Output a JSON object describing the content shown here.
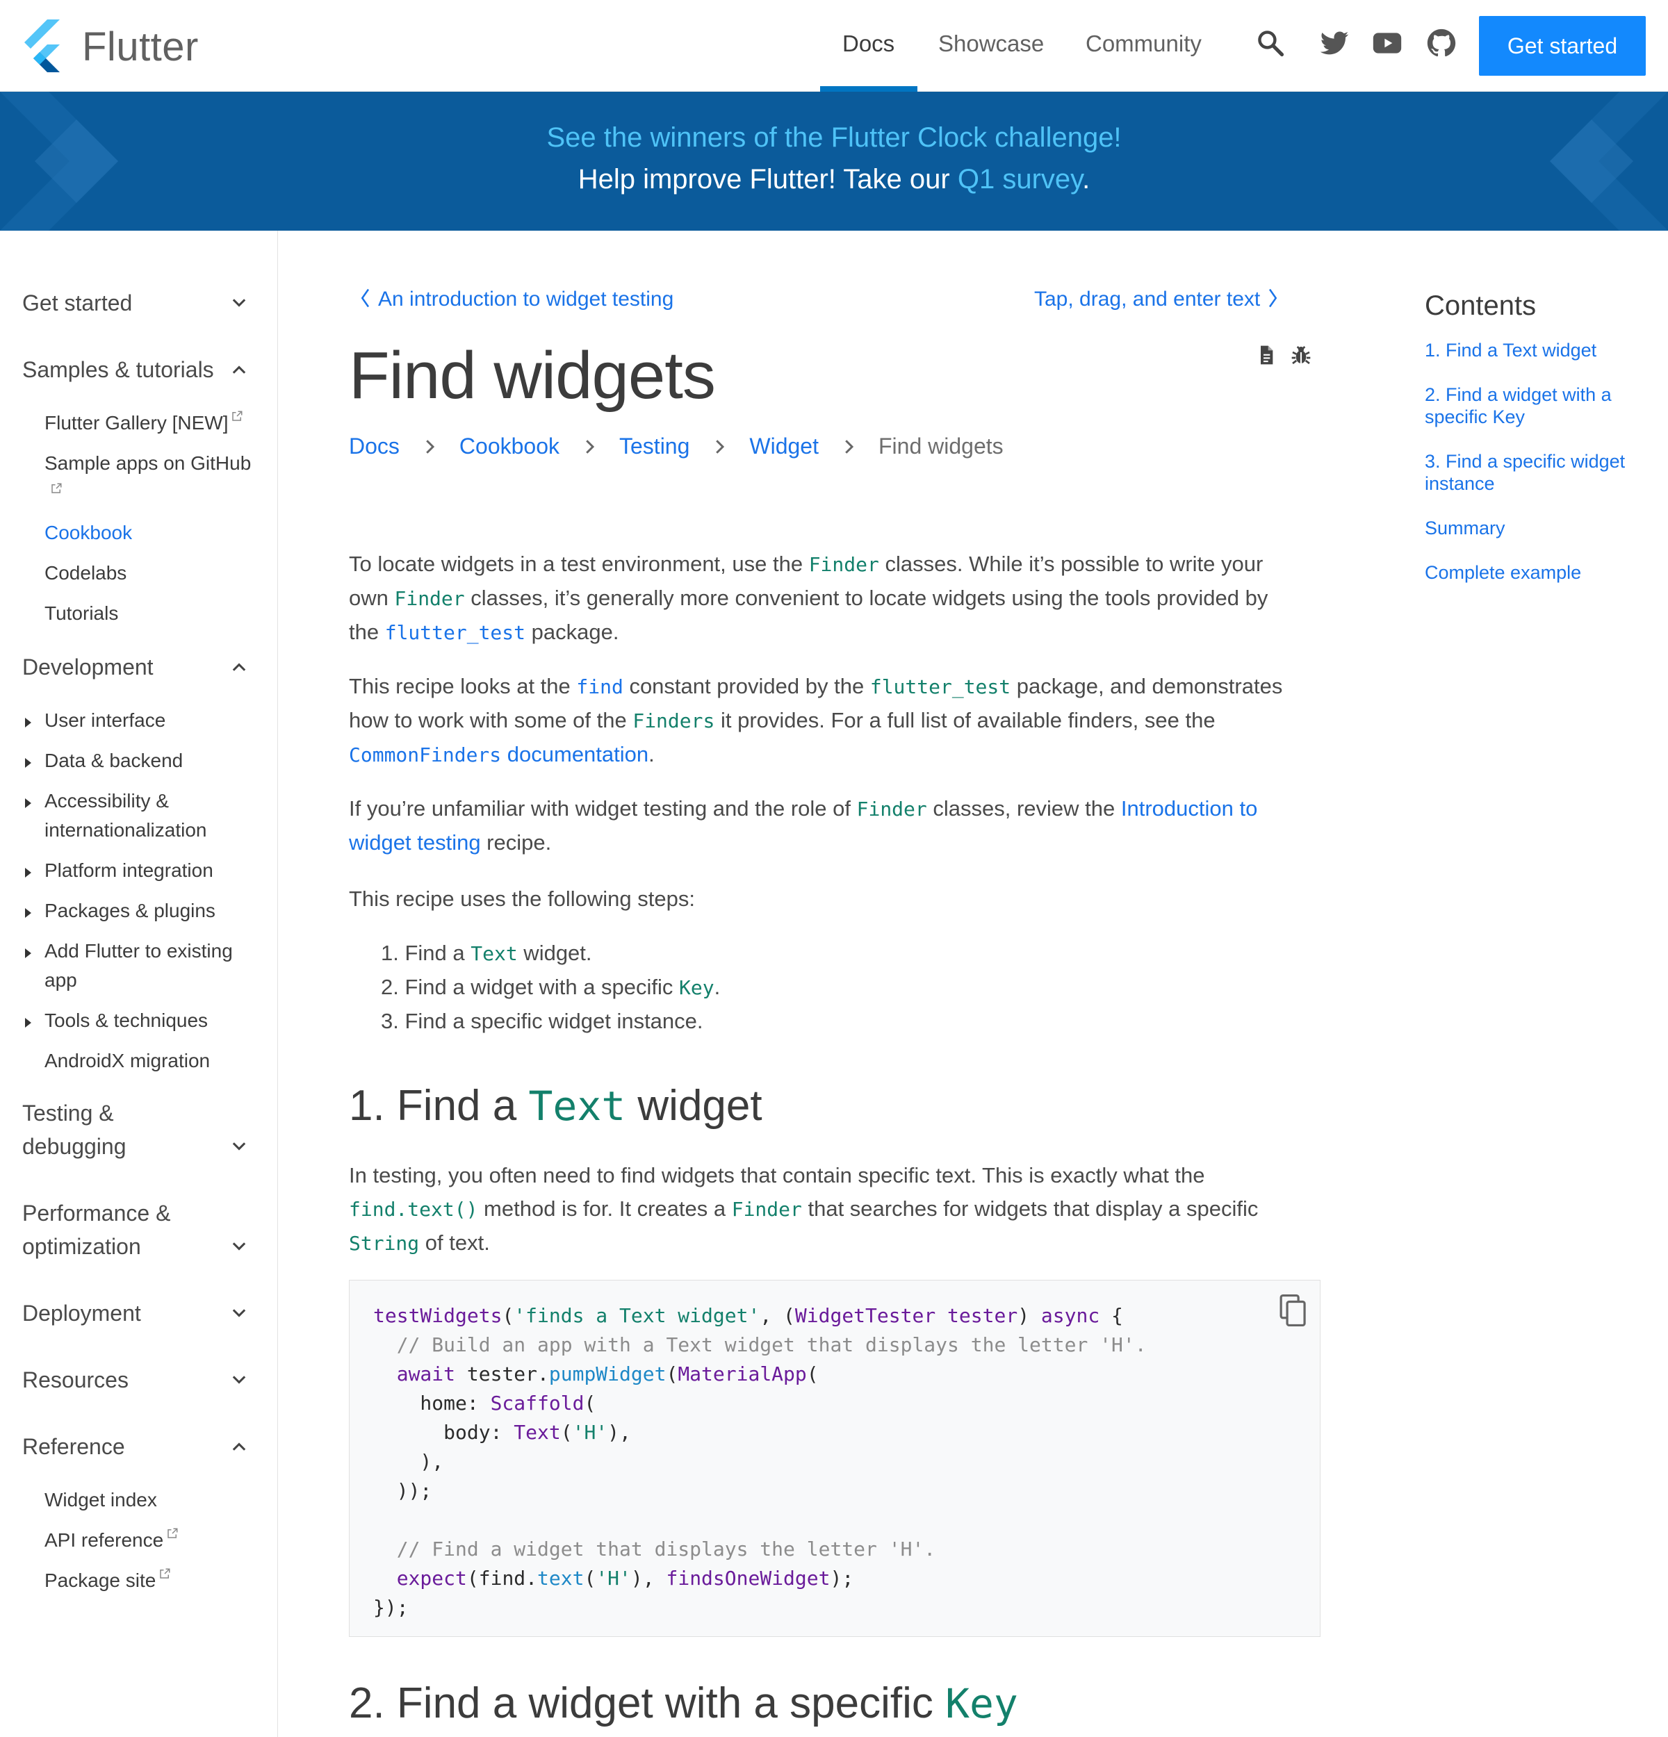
{
  "header": {
    "brand": "Flutter",
    "nav": [
      "Docs",
      "Showcase",
      "Community"
    ],
    "cta": "Get started",
    "icons": [
      "search-icon",
      "twitter-icon",
      "youtube-icon",
      "github-icon"
    ]
  },
  "banner": {
    "line1": "See the winners of the Flutter Clock challenge!",
    "line2_pre": "Help improve Flutter! Take our ",
    "line2_link": "Q1 survey",
    "line2_post": "."
  },
  "sidebar": {
    "sections": [
      {
        "label": "Get started",
        "expanded": false
      },
      {
        "label": "Samples & tutorials",
        "expanded": true,
        "items": [
          "Flutter Gallery [NEW]",
          "Sample apps on GitHub",
          "Cookbook",
          "Codelabs",
          "Tutorials"
        ]
      },
      {
        "label": "Development",
        "expanded": true,
        "items": [
          "User interface",
          "Data & backend",
          "Accessibility &",
          "internationalization",
          "Platform integration",
          "Packages & plugins",
          "Add Flutter to existing",
          "app",
          "Tools & techniques",
          "AndroidX migration"
        ]
      },
      {
        "label_line1": "Testing &",
        "label_line2": "debugging",
        "expanded": false
      },
      {
        "label_line1": "Performance &",
        "label_line2": "optimization",
        "expanded": false
      },
      {
        "label": "Deployment",
        "expanded": false
      },
      {
        "label": "Resources",
        "expanded": false
      },
      {
        "label": "Reference",
        "expanded": true,
        "items": [
          "Widget index",
          "API reference",
          "Package site"
        ]
      }
    ],
    "active_item": "Cookbook"
  },
  "main": {
    "prev": "An introduction to widget testing",
    "next": "Tap, drag, and enter text",
    "title": "Find widgets",
    "breadcrumb": [
      "Docs",
      "Cookbook",
      "Testing",
      "Widget",
      "Find widgets"
    ],
    "p1": {
      "a": "To locate widgets in a test environment, use the ",
      "b": "Finder",
      "c": " classes. While it’s possible to write your",
      "d": "own ",
      "e": "Finder",
      "f": " classes, it’s generally more convenient to locate widgets using the tools provided by",
      "g": "the ",
      "h": "flutter_test",
      "i": " package."
    },
    "p2": {
      "a": "This recipe looks at the ",
      "b": "find",
      "c": " constant provided by the ",
      "d": "flutter_test",
      "e": " package, and demonstrates",
      "f": "how to work with some of the ",
      "g": "Finders",
      "h": " it provides. For a full list of available finders, see the",
      "i": "CommonFinders",
      "j": " documentation",
      "k": "."
    },
    "p3": {
      "a": "If you’re unfamiliar with widget testing and the role of ",
      "b": "Finder",
      "c": " classes, review the ",
      "d": "Introduction to",
      "e": "widget testing",
      "f": " recipe."
    },
    "p4": "This recipe uses the following steps:",
    "steps": [
      {
        "pre": "1. Find a ",
        "code": "Text",
        "post": " widget."
      },
      {
        "pre": "2. Find a widget with a specific ",
        "code": "Key",
        "post": "."
      },
      {
        "pre": "3. Find a specific widget instance.",
        "code": "",
        "post": ""
      }
    ],
    "h1": {
      "pre": "1. Find a ",
      "code": "Text",
      "post": " widget"
    },
    "p5": {
      "a": "In testing, you often need to find widgets that contain specific text. This is exactly what the",
      "b": "find.text()",
      "c": " method is for. It creates a ",
      "d": "Finder",
      "e": " that searches for widgets that display a specific",
      "f": "String",
      "g": " of text."
    },
    "h2": {
      "pre": "2. Find a widget with a specific ",
      "code": "Key"
    }
  },
  "toc": {
    "title": "Contents",
    "items": [
      "1. Find a Text widget",
      "2. Find a widget with a specific Key",
      "3. Find a specific widget instance",
      "Summary",
      "Complete example"
    ]
  },
  "colors": {
    "accent": "#1389fd",
    "link": "#1a73e8",
    "banner": "#0b5b9b",
    "code_green": "#13806b"
  }
}
